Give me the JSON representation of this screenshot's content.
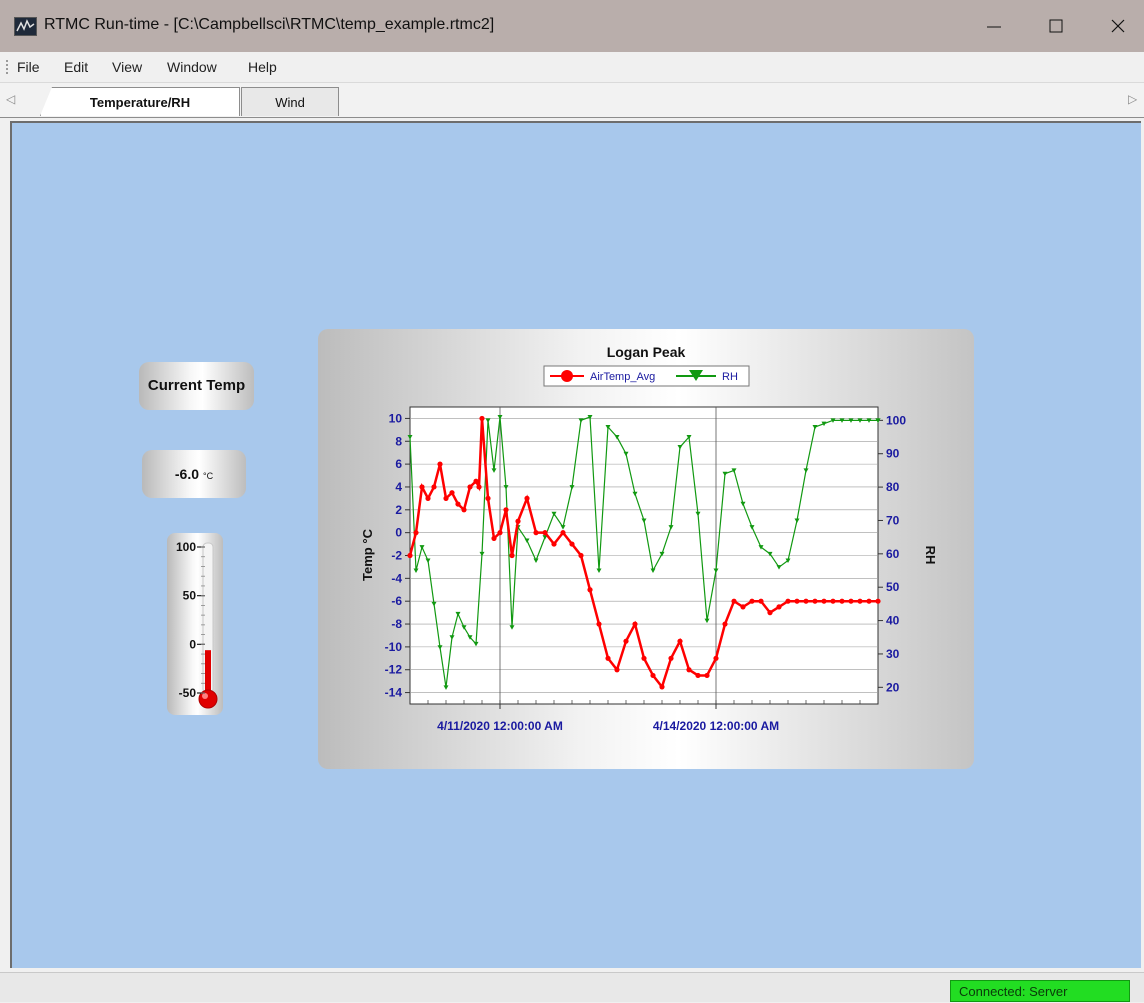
{
  "window": {
    "title": "RTMC Run-time - [C:\\Campbellsci\\RTMC\\temp_example.rtmc2]",
    "controls": [
      "minimize",
      "maximize",
      "close"
    ]
  },
  "menu": {
    "items": [
      {
        "id": "file",
        "label": "File"
      },
      {
        "id": "edit",
        "label": "Edit"
      },
      {
        "id": "view",
        "label": "View"
      },
      {
        "id": "window",
        "label": "Window"
      },
      {
        "id": "help",
        "label": "Help"
      }
    ]
  },
  "tabs": {
    "items": [
      {
        "id": "temperature-rh",
        "label": "Temperature/RH",
        "active": true
      },
      {
        "id": "wind",
        "label": "Wind",
        "active": false
      }
    ]
  },
  "widgets": {
    "current_temp_label": "Current Temp",
    "current_temp_value": "-6.0",
    "current_temp_unit": "°C",
    "thermometer": {
      "ticks": [
        "100",
        "50",
        "0",
        "-50"
      ],
      "min": -50,
      "max": 100,
      "value": -6.0,
      "fill_color": "#e00000"
    }
  },
  "chart_data": {
    "type": "line",
    "title": "Logan Peak",
    "ylabel": "Temp °C",
    "y2label": "RH",
    "ylim": [
      -15,
      11
    ],
    "y2lim": [
      15,
      104
    ],
    "yticks": [
      "10",
      "8",
      "6",
      "4",
      "2",
      "0",
      "-2",
      "-4",
      "-6",
      "-8",
      "-10",
      "-12",
      "-14"
    ],
    "y2ticks": [
      "100",
      "90",
      "80",
      "70",
      "60",
      "50",
      "40",
      "30",
      "20"
    ],
    "xticks": [
      "4/11/2020 12:00:00 AM",
      "4/14/2020 12:00:00 AM"
    ],
    "xlim": [
      "4/9/2020 6:00:00 PM",
      "4/16/2020 6:00:00 AM"
    ],
    "grid": true,
    "legend_position": "top-center",
    "series": [
      {
        "name": "AirTemp_Avg",
        "axis": "left",
        "color": "#ff0000",
        "marker": "circle",
        "x": [
          "4/9/2020 6:00:00 PM",
          "4/9/2020 8:00:00 PM",
          "4/9/2020 10:00:00 PM",
          "4/10/2020 12:00:00 AM",
          "4/10/2020 2:00:00 AM",
          "4/10/2020 4:00:00 AM",
          "4/10/2020 6:00:00 AM",
          "4/10/2020 8:00:00 AM",
          "4/10/2020 10:00:00 AM",
          "4/10/2020 12:00:00 PM",
          "4/10/2020 2:00:00 PM",
          "4/10/2020 4:00:00 PM",
          "4/10/2020 5:00:00 PM",
          "4/10/2020 6:00:00 PM",
          "4/10/2020 8:00:00 PM",
          "4/10/2020 10:00:00 PM",
          "4/11/2020 12:00:00 AM",
          "4/11/2020 2:00:00 AM",
          "4/11/2020 4:00:00 AM",
          "4/11/2020 6:00:00 AM",
          "4/11/2020 9:00:00 AM",
          "4/11/2020 12:00:00 PM",
          "4/11/2020 3:00:00 PM",
          "4/11/2020 6:00:00 PM",
          "4/11/2020 9:00:00 PM",
          "4/12/2020 12:00:00 AM",
          "4/12/2020 3:00:00 AM",
          "4/12/2020 6:00:00 AM",
          "4/12/2020 9:00:00 AM",
          "4/12/2020 12:00:00 PM",
          "4/12/2020 3:00:00 PM",
          "4/12/2020 6:00:00 PM",
          "4/12/2020 9:00:00 PM",
          "4/13/2020 12:00:00 AM",
          "4/13/2020 3:00:00 AM",
          "4/13/2020 6:00:00 AM",
          "4/13/2020 9:00:00 AM",
          "4/13/2020 12:00:00 PM",
          "4/13/2020 3:00:00 PM",
          "4/13/2020 6:00:00 PM",
          "4/13/2020 9:00:00 PM",
          "4/14/2020 12:00:00 AM",
          "4/14/2020 3:00:00 AM",
          "4/14/2020 6:00:00 AM",
          "4/14/2020 9:00:00 AM",
          "4/14/2020 12:00:00 PM",
          "4/14/2020 3:00:00 PM",
          "4/14/2020 6:00:00 PM",
          "4/14/2020 9:00:00 PM",
          "4/15/2020 12:00:00 AM",
          "4/15/2020 3:00:00 AM",
          "4/15/2020 6:00:00 AM",
          "4/15/2020 9:00:00 AM",
          "4/15/2020 12:00:00 PM",
          "4/15/2020 3:00:00 PM",
          "4/15/2020 6:00:00 PM",
          "4/15/2020 9:00:00 PM",
          "4/16/2020 12:00:00 AM",
          "4/16/2020 3:00:00 AM",
          "4/16/2020 6:00:00 AM"
        ],
        "y": [
          -2,
          0,
          4,
          3,
          4,
          6,
          3,
          3.5,
          2.5,
          2,
          4,
          4.5,
          4,
          10,
          3,
          -0.5,
          0,
          2,
          -2,
          1,
          3,
          0,
          0,
          -1,
          0,
          -1,
          -2,
          -5,
          -8,
          -11,
          -12,
          -9.5,
          -8,
          -11,
          -12.5,
          -13.5,
          -11,
          -9.5,
          -12,
          -12.5,
          -12.5,
          -11,
          -8,
          -6,
          -6.5,
          -6,
          -6,
          -7,
          -6.5,
          -6,
          -6,
          -6,
          -6,
          -6,
          -6,
          -6,
          -6,
          -6,
          -6,
          -6
        ]
      },
      {
        "name": "RH",
        "axis": "right",
        "color": "#119911",
        "marker": "triangle-down",
        "x": [
          "4/9/2020 6:00:00 PM",
          "4/9/2020 8:00:00 PM",
          "4/9/2020 10:00:00 PM",
          "4/10/2020 12:00:00 AM",
          "4/10/2020 2:00:00 AM",
          "4/10/2020 4:00:00 AM",
          "4/10/2020 6:00:00 AM",
          "4/10/2020 8:00:00 AM",
          "4/10/2020 10:00:00 AM",
          "4/10/2020 12:00:00 PM",
          "4/10/2020 2:00:00 PM",
          "4/10/2020 4:00:00 PM",
          "4/10/2020 6:00:00 PM",
          "4/10/2020 8:00:00 PM",
          "4/10/2020 10:00:00 PM",
          "4/11/2020 12:00:00 AM",
          "4/11/2020 2:00:00 AM",
          "4/11/2020 4:00:00 AM",
          "4/11/2020 6:00:00 AM",
          "4/11/2020 9:00:00 AM",
          "4/11/2020 12:00:00 PM",
          "4/11/2020 3:00:00 PM",
          "4/11/2020 6:00:00 PM",
          "4/11/2020 9:00:00 PM",
          "4/12/2020 12:00:00 AM",
          "4/12/2020 3:00:00 AM",
          "4/12/2020 6:00:00 AM",
          "4/12/2020 9:00:00 AM",
          "4/12/2020 12:00:00 PM",
          "4/12/2020 3:00:00 PM",
          "4/12/2020 6:00:00 PM",
          "4/12/2020 9:00:00 PM",
          "4/13/2020 12:00:00 AM",
          "4/13/2020 3:00:00 AM",
          "4/13/2020 6:00:00 AM",
          "4/13/2020 9:00:00 AM",
          "4/13/2020 12:00:00 PM",
          "4/13/2020 3:00:00 PM",
          "4/13/2020 6:00:00 PM",
          "4/13/2020 9:00:00 PM",
          "4/14/2020 12:00:00 AM",
          "4/14/2020 3:00:00 AM",
          "4/14/2020 6:00:00 AM",
          "4/14/2020 9:00:00 AM",
          "4/14/2020 12:00:00 PM",
          "4/14/2020 3:00:00 PM",
          "4/14/2020 6:00:00 PM",
          "4/14/2020 9:00:00 PM",
          "4/15/2020 12:00:00 AM",
          "4/15/2020 3:00:00 AM",
          "4/15/2020 6:00:00 AM",
          "4/15/2020 9:00:00 AM",
          "4/15/2020 12:00:00 PM",
          "4/15/2020 3:00:00 PM",
          "4/15/2020 6:00:00 PM",
          "4/15/2020 9:00:00 PM",
          "4/16/2020 12:00:00 AM",
          "4/16/2020 3:00:00 AM",
          "4/16/2020 6:00:00 AM",
          "4/16/2020 6:00:00 AM"
        ],
        "y": [
          95,
          55,
          62,
          58,
          45,
          32,
          20,
          35,
          42,
          38,
          35,
          33,
          60,
          100,
          85,
          101,
          80,
          38,
          68,
          64,
          58,
          65,
          72,
          68,
          80,
          100,
          101,
          55,
          98,
          95,
          90,
          78,
          70,
          55,
          60,
          68,
          92,
          95,
          72,
          40,
          55,
          84,
          85,
          75,
          68,
          62,
          60,
          56,
          58,
          70,
          85,
          98,
          99,
          100,
          100,
          100,
          100,
          100,
          100,
          100
        ]
      }
    ]
  },
  "status": {
    "connection": "Connected: Server"
  }
}
